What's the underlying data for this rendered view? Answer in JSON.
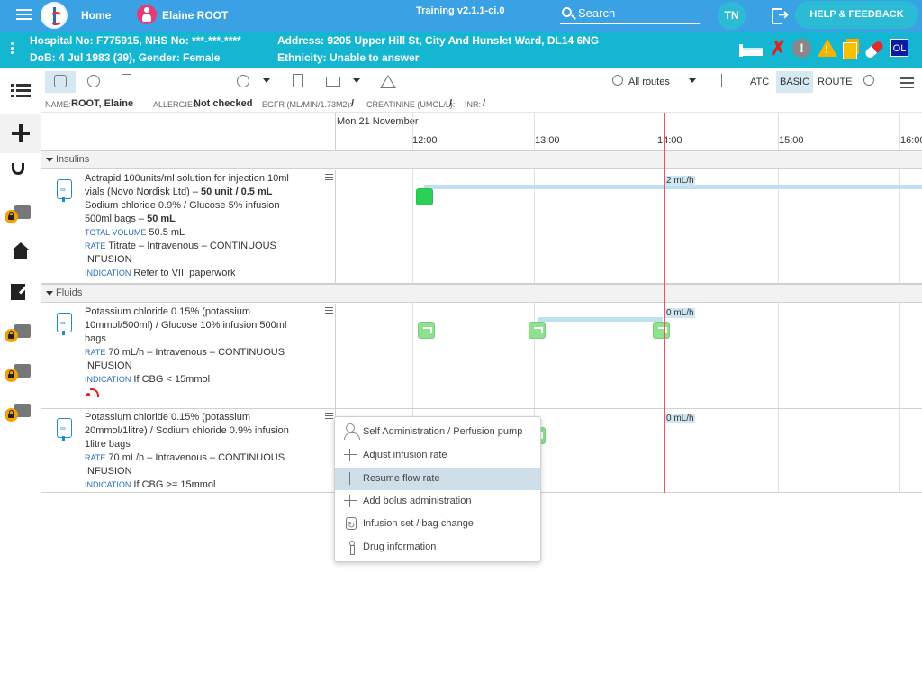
{
  "topbar": {
    "home_label": "Home",
    "patient_name": "Elaine ROOT",
    "build": "Training v2.1.1-ci.0",
    "search_label": "Search",
    "user_initials": "TN",
    "help_label": "HELP & FEEDBACK"
  },
  "banner": {
    "hospital": "Hospital No: F775915, NHS No: ***-***-****",
    "dob": "DoB: 4 Jul 1983 (39), Gender: Female",
    "address": "Address: 9205 Upper Hill St, City And Hunslet Ward, DL14 6NG",
    "ethnicity": "Ethnicity: Unable to answer",
    "alert_initials": "OL"
  },
  "toolbar": {
    "routes_label": "All routes",
    "atc_label": "ATC",
    "basic_label": "BASIC",
    "route_label": "ROUTE"
  },
  "infoline": {
    "name_label": "NAME:",
    "name_value": "ROOT, Elaine",
    "allergies_label": "ALLERGIES:",
    "allergies_value": "Not checked",
    "egfr_label": "EGFR (ML/MIN/1.73M2):",
    "egfr_value": "/",
    "creat_label": "CREATININE (UMOL/L):",
    "creat_value": "/",
    "inr_label": "INR:",
    "inr_value": "/"
  },
  "timeline": {
    "date": "Mon 21 November",
    "hours": [
      "12:00",
      "13:00",
      "14:00",
      "15:00",
      "16:00"
    ]
  },
  "sections": {
    "insulins": "Insulins",
    "fluids": "Fluids"
  },
  "rows": [
    {
      "line1": "Actrapid 100units/ml solution for injection 10ml",
      "line2a": "vials (Novo Nordisk Ltd) – ",
      "line2b": "50 unit / 0.5 mL",
      "line3": "Sodium chloride 0.9% / Glucose 5% infusion",
      "line4a": "500ml bags – ",
      "line4b": "50 mL",
      "tv_label": "TOTAL VOLUME",
      "tv_value": "50.5 mL",
      "rate_label": "RATE",
      "rate_value": "Titrate – Intravenous – CONTINUOUS",
      "rate_value2": "INFUSION",
      "ind_label": "INDICATION",
      "ind_value": "Refer to VIII paperwork",
      "flow_label": "2 mL/h"
    },
    {
      "line1": "Potassium chloride 0.15% (potassium",
      "line2": "10mmol/500ml) / Glucose 10% infusion 500ml",
      "line3": "bags",
      "rate_label": "RATE",
      "rate_value": "70 mL/h – Intravenous – CONTINUOUS",
      "rate_value2": "INFUSION",
      "ind_label": "INDICATION",
      "ind_value": "If CBG < 15mmol",
      "flow_label": "0 mL/h"
    },
    {
      "line1": "Potassium chloride 0.15% (potassium",
      "line2": "20mmol/1litre) / Sodium chloride 0.9% infusion",
      "line3": "1litre bags",
      "rate_label": "RATE",
      "rate_value": "70 mL/h – Intravenous – CONTINUOUS",
      "rate_value2": "INFUSION",
      "ind_label": "INDICATION",
      "ind_value": "If CBG >= 15mmol",
      "flow_label": "0 mL/h"
    }
  ],
  "context_menu": [
    {
      "label": "Self Administration / Perfusion pump",
      "icon": "person-icon"
    },
    {
      "label": "Adjust infusion rate",
      "icon": "plus-icon"
    },
    {
      "label": "Resume flow rate",
      "icon": "plus-icon",
      "highlighted": true
    },
    {
      "label": "Add bolus administration",
      "icon": "plus-icon"
    },
    {
      "label": "Infusion set / bag change",
      "icon": "bag-change-icon"
    },
    {
      "label": "Drug information",
      "icon": "info-icon"
    }
  ],
  "colors": {
    "topbar": "#3aa1e4",
    "banner": "#15b6d2",
    "now_line": "#e25d4e",
    "marker": "#2ad155"
  }
}
